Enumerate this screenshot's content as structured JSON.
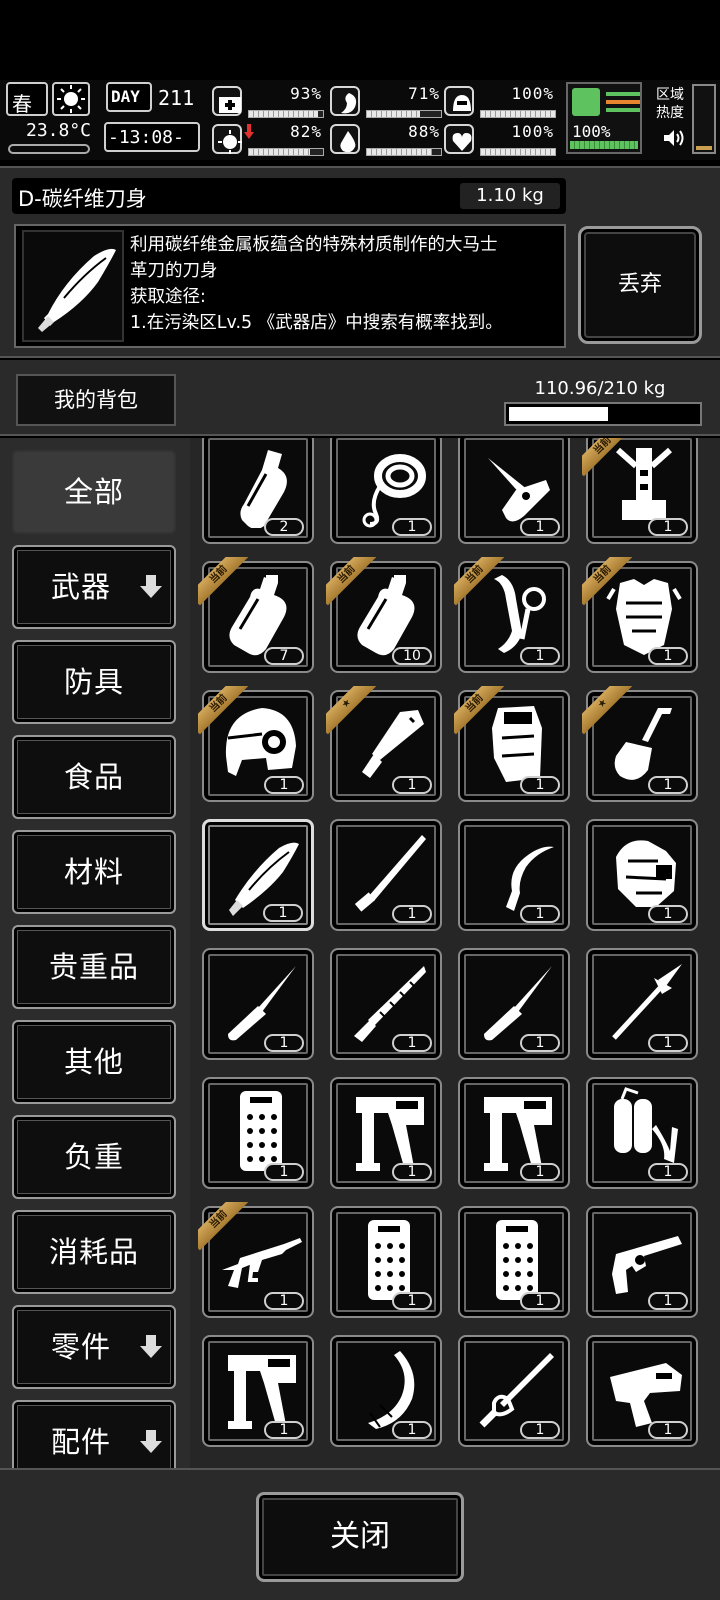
{
  "hud": {
    "season": "春",
    "temperature": "23.8°C",
    "day_label": "DAY",
    "day_number": "211",
    "clock": "-13:08-",
    "stats": [
      {
        "name": "health",
        "icon": "medkit-icon",
        "value": "93%",
        "level": 0.93
      },
      {
        "name": "hunger",
        "icon": "stomach-icon",
        "value": "71%",
        "level": 0.71
      },
      {
        "name": "protection",
        "icon": "helmet-icon",
        "value": "100%",
        "level": 1.0
      },
      {
        "name": "virus",
        "icon": "virus-icon",
        "value": "82%",
        "level": 0.82
      },
      {
        "name": "thirst",
        "icon": "water-drop-icon",
        "value": "88%",
        "level": 0.88
      },
      {
        "name": "mood",
        "icon": "heart-icon",
        "value": "100%",
        "level": 1.0
      }
    ],
    "stamina_value": "100%",
    "zone_heat_label": "区域\n热度"
  },
  "detail": {
    "item_name": "D-碳纤维刀身",
    "item_weight": "1.10 kg",
    "description": "利用碳纤维金属板蕴含的特殊材质制作的大马士\n革刀的刀身\n获取途径:\n1.在污染区Lv.5 《武器店》中搜索有概率找到。",
    "discard_label": "丢弃"
  },
  "backpack": {
    "title": "我的背包",
    "capacity": "110.96/210 kg",
    "capacity_level": 0.528
  },
  "categories": [
    {
      "label": "全部",
      "active": true,
      "has_arrow": false
    },
    {
      "label": "武器",
      "active": false,
      "has_arrow": true
    },
    {
      "label": "防具",
      "active": false,
      "has_arrow": false
    },
    {
      "label": "食品",
      "active": false,
      "has_arrow": false
    },
    {
      "label": "材料",
      "active": false,
      "has_arrow": false
    },
    {
      "label": "贵重品",
      "active": false,
      "has_arrow": false
    },
    {
      "label": "其他",
      "active": false,
      "has_arrow": false
    },
    {
      "label": "负重",
      "active": false,
      "has_arrow": false
    },
    {
      "label": "消耗品",
      "active": false,
      "has_arrow": false
    },
    {
      "label": "零件",
      "active": false,
      "has_arrow": true
    },
    {
      "label": "配件",
      "active": false,
      "has_arrow": true
    }
  ],
  "ribbon_text": "当前",
  "items": [
    {
      "icon": "bottle-icon",
      "count": "2",
      "ribbon": null
    },
    {
      "icon": "rope-icon",
      "count": "1",
      "ribbon": null
    },
    {
      "icon": "folding-knife-icon",
      "count": "1",
      "ribbon": null
    },
    {
      "icon": "exoskeleton-icon",
      "count": "1",
      "ribbon": "current"
    },
    {
      "icon": "water-bag-icon",
      "count": "7",
      "ribbon": "current"
    },
    {
      "icon": "water-bag-icon",
      "count": "10",
      "ribbon": "current"
    },
    {
      "icon": "arm-armor-icon",
      "count": "1",
      "ribbon": "current"
    },
    {
      "icon": "body-armor-icon",
      "count": "1",
      "ribbon": "current"
    },
    {
      "icon": "tactical-helmet-icon",
      "count": "1",
      "ribbon": "current"
    },
    {
      "icon": "machete-icon",
      "count": "1",
      "ribbon": "star"
    },
    {
      "icon": "backpack-icon",
      "count": "1",
      "ribbon": "current"
    },
    {
      "icon": "shovel-icon",
      "count": "1",
      "ribbon": "star"
    },
    {
      "icon": "carbon-blade-icon",
      "count": "1",
      "ribbon": null,
      "selected": true
    },
    {
      "icon": "katana-blade-icon",
      "count": "1",
      "ribbon": null
    },
    {
      "icon": "kukri-icon",
      "count": "1",
      "ribbon": null
    },
    {
      "icon": "shoulder-armor-icon",
      "count": "1",
      "ribbon": null
    },
    {
      "icon": "stiletto-icon",
      "count": "1",
      "ribbon": null
    },
    {
      "icon": "saw-blade-icon",
      "count": "1",
      "ribbon": null
    },
    {
      "icon": "stiletto-icon",
      "count": "1",
      "ribbon": null
    },
    {
      "icon": "spear-icon",
      "count": "1",
      "ribbon": null
    },
    {
      "icon": "riot-shield-icon",
      "count": "1",
      "ribbon": null
    },
    {
      "icon": "nail-gun-icon",
      "count": "1",
      "ribbon": null
    },
    {
      "icon": "nail-gun-icon",
      "count": "1",
      "ribbon": null
    },
    {
      "icon": "flamethrower-icon",
      "count": "1",
      "ribbon": null
    },
    {
      "icon": "assault-rifle-icon",
      "count": "1",
      "ribbon": "current"
    },
    {
      "icon": "riot-shield-icon",
      "count": "1",
      "ribbon": null
    },
    {
      "icon": "riot-shield-icon",
      "count": "1",
      "ribbon": null
    },
    {
      "icon": "revolver-icon",
      "count": "1",
      "ribbon": null
    },
    {
      "icon": "nail-gun-icon",
      "count": "1",
      "ribbon": null
    },
    {
      "icon": "sickle-blade-icon",
      "count": "1",
      "ribbon": null
    },
    {
      "icon": "sabre-icon",
      "count": "1",
      "ribbon": null
    },
    {
      "icon": "heavy-pistol-icon",
      "count": "1",
      "ribbon": null
    }
  ],
  "footer": {
    "close_label": "关闭"
  }
}
